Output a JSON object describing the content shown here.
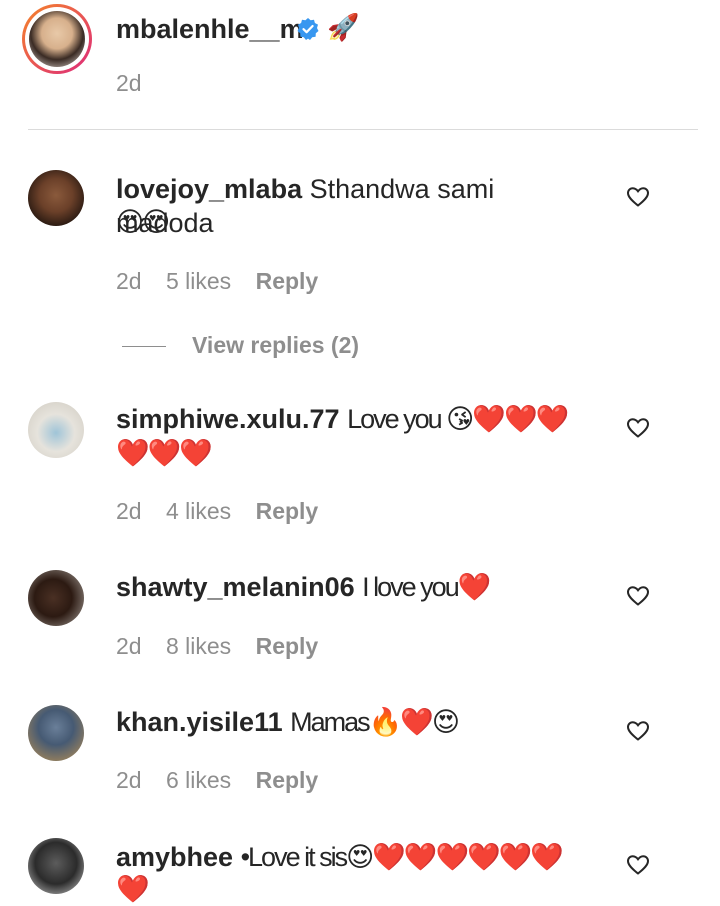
{
  "post": {
    "author": "mbalenhle__m",
    "caption_emoji": "🚀",
    "time": "2d"
  },
  "comments": [
    {
      "username": "lovejoy_mlaba",
      "text": "Sthandwa sami madoda",
      "text_line2": "😍😍",
      "time": "2d",
      "likes": "5 likes",
      "reply_label": "Reply",
      "view_replies": "View replies (2)"
    },
    {
      "username": "simphiwe.xulu.77",
      "text": "Love you 😘❤️❤️❤️",
      "text_line2": "❤️❤️❤️",
      "time": "2d",
      "likes": "4 likes",
      "reply_label": "Reply"
    },
    {
      "username": "shawty_melanin06",
      "text": "I love you❤️",
      "time": "2d",
      "likes": "8 likes",
      "reply_label": "Reply"
    },
    {
      "username": "khan.yisile11",
      "text": "Mamas🔥❤️😍",
      "time": "2d",
      "likes": "6 likes",
      "reply_label": "Reply"
    },
    {
      "username": "amybhee",
      "text": "•Love it sis😍❤️❤️❤️❤️❤️❤️",
      "text_line2": "❤️"
    }
  ],
  "colors": {
    "verified": "#3897f0",
    "story_ring_start": "#f58529",
    "story_ring_end": "#dd2a7b",
    "meta": "#8e8e8e",
    "divider": "#dbdbdb"
  },
  "icons": {
    "verified": "verified-badge-icon",
    "like": "heart-outline-icon"
  }
}
